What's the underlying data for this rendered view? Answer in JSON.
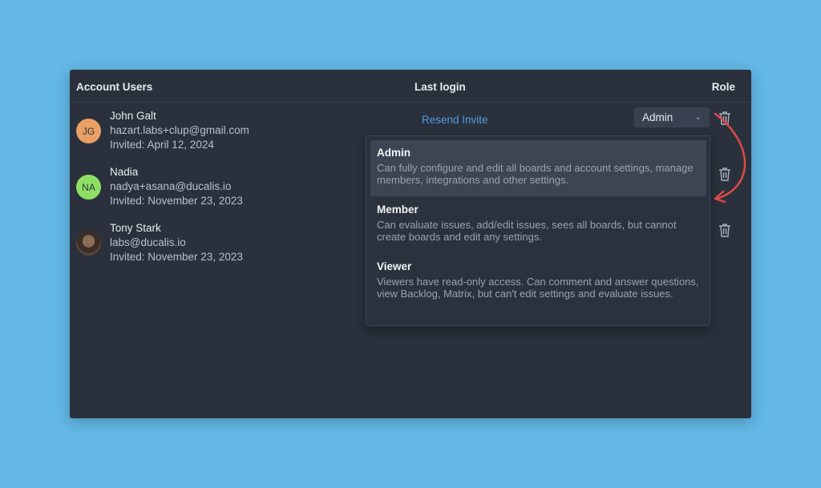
{
  "table": {
    "headers": {
      "users": "Account Users",
      "last_login": "Last login",
      "role": "Role"
    }
  },
  "users": [
    {
      "initials": "JG",
      "name": "John Galt",
      "email": "hazart.labs+clup@gmail.com",
      "invited": "Invited: April 12, 2024",
      "avatar_color": "#e9a064"
    },
    {
      "initials": "NA",
      "name": "Nadia",
      "email": "nadya+asana@ducalis.io",
      "invited": "Invited: November 23, 2023",
      "avatar_color": "#8ee065"
    },
    {
      "initials": "",
      "name": "Tony Stark",
      "email": "labs@ducalis.io",
      "invited": "Invited: November 23, 2023",
      "avatar": "photo"
    }
  ],
  "resend_invite": "Resend Invite",
  "role_select": {
    "value": "Admin"
  },
  "role_options": [
    {
      "title": "Admin",
      "description": "Can fully configure and edit all boards and account settings, manage members, integrations and other settings.",
      "selected": true
    },
    {
      "title": "Member",
      "description": "Can evaluate issues, add/edit issues, sees all boards, but cannot create boards and edit any settings.",
      "selected": false
    },
    {
      "title": "Viewer",
      "description": "Viewers have read-only access. Can comment and answer questions, view Backlog, Matrix, but can't edit settings and evaluate issues.",
      "selected": false
    }
  ],
  "colors": {
    "background": "#63b8e6",
    "panel": "#2a313c",
    "link": "#4f9ce8",
    "annotation_arrow": "#e0484a"
  }
}
